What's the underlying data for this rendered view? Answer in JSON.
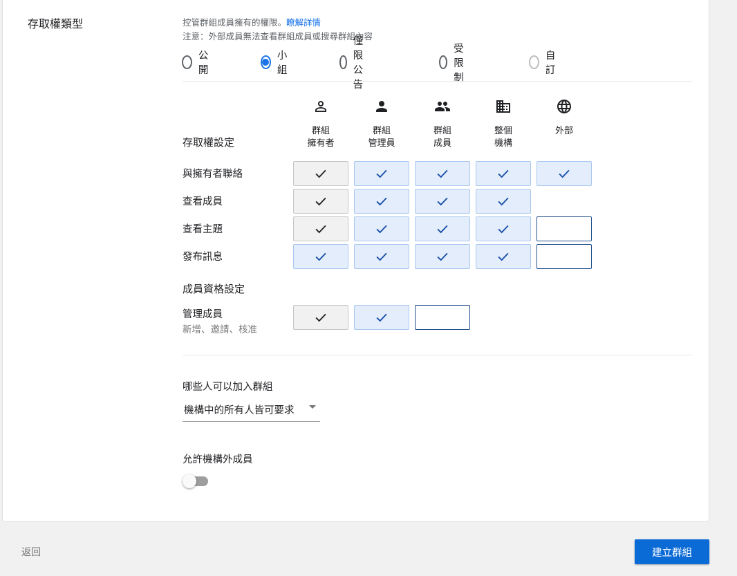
{
  "section_title": "存取權類型",
  "description": {
    "line1_text": "控管群組成員擁有的權限。",
    "line1_link": "瞭解詳情",
    "line2": "注意：外部成員無法查看群組成員或搜尋群組內容"
  },
  "access_types": [
    {
      "label": "公開",
      "state": "unchecked"
    },
    {
      "label": "小組",
      "state": "checked"
    },
    {
      "label": "僅限公告",
      "state": "unchecked"
    },
    {
      "label": "受限制",
      "state": "unchecked"
    },
    {
      "label": "自訂",
      "state": "disabled"
    }
  ],
  "access_settings_label": "存取權設定",
  "columns": [
    {
      "icon": "person-outline-icon",
      "label": "群組\n擁有者"
    },
    {
      "icon": "person-icon",
      "label": "群組\n管理員"
    },
    {
      "icon": "people-icon",
      "label": "群組\n成員"
    },
    {
      "icon": "building-icon",
      "label": "整個\n機構"
    },
    {
      "icon": "globe-icon",
      "label": "外部"
    }
  ],
  "access_rows": [
    {
      "label": "與擁有者聯絡",
      "cells": [
        "locked",
        "on",
        "on",
        "on",
        "on"
      ]
    },
    {
      "label": "查看成員",
      "cells": [
        "locked",
        "on",
        "on",
        "on",
        "none"
      ]
    },
    {
      "label": "查看主題",
      "cells": [
        "locked",
        "on",
        "on",
        "on",
        "off"
      ]
    },
    {
      "label": "發布訊息",
      "cells": [
        "on",
        "on",
        "on",
        "on",
        "off"
      ]
    }
  ],
  "membership_settings_label": "成員資格設定",
  "membership_rows": [
    {
      "label": "管理成員",
      "sublabel": "新增、邀請、核准",
      "cells": [
        "locked",
        "on",
        "off",
        "none",
        "none"
      ]
    }
  ],
  "join": {
    "label": "哪些人可以加入群組",
    "selected": "機構中的所有人皆可要求"
  },
  "external": {
    "label": "允許機構外成員",
    "enabled": false
  },
  "footer": {
    "back_label": "返回",
    "create_label": "建立群組"
  },
  "colors": {
    "accent": "#1a73e8",
    "primary_button": "#0b6bd6",
    "cell_on_bg": "#e3edfb",
    "cell_locked_bg": "#f1f1f1"
  }
}
